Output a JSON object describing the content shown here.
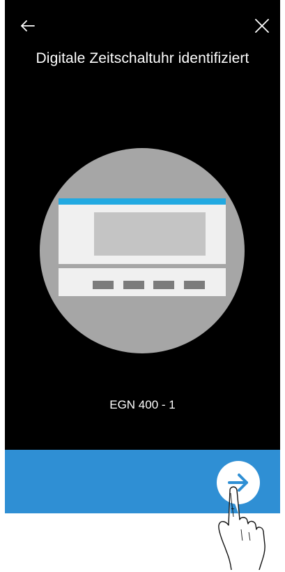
{
  "header": {
    "back_icon": "arrow-left-icon",
    "close_icon": "close-icon",
    "title": "Digitale Zeitschaltuhr identifiziert"
  },
  "device": {
    "illustration_icon": "timer-device-illustration",
    "name": "EGN 400 - 1"
  },
  "footer": {
    "next_icon": "arrow-right-icon"
  },
  "colors": {
    "background": "#000000",
    "accent": "#2f8fd4",
    "circle": "#a6a6a6",
    "device_body": "#f0f0f0",
    "device_strip": "#22a9e1",
    "display": "#c4c4c4",
    "keys": "#7c7c7c"
  }
}
